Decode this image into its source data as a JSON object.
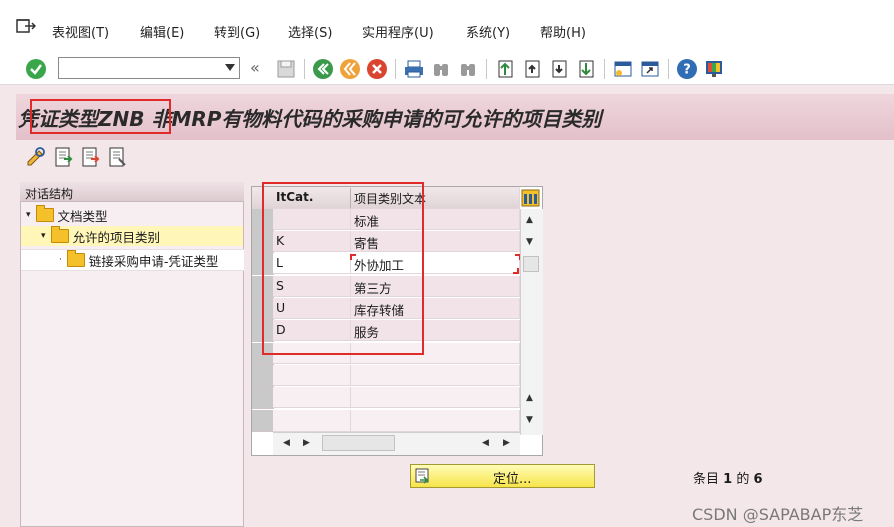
{
  "menu": {
    "items": [
      "表视图(T)",
      "编辑(E)",
      "转到(G)",
      "选择(S)",
      "实用程序(U)",
      "系统(Y)",
      "帮助(H)"
    ]
  },
  "toolbar": {
    "command_field": ""
  },
  "title": {
    "prefix": "凭证类型",
    "doc_type": "ZNB",
    "suffix": " 非MRP有物料代码的采购申请的可允许的项目类别"
  },
  "nav": {
    "header": "对话结构",
    "items": [
      {
        "label": "文档类型",
        "level": 0,
        "expanded": true
      },
      {
        "label": "允许的项目类别",
        "level": 1,
        "expanded": true,
        "selected": true
      },
      {
        "label": "链接采购申请-凭证类型",
        "level": 2,
        "expanded": false
      }
    ]
  },
  "table": {
    "columns": [
      "ItCat.",
      "项目类别文本"
    ],
    "rows": [
      [
        "",
        "标准"
      ],
      [
        "K",
        "寄售"
      ],
      [
        "L",
        "外协加工"
      ],
      [
        "S",
        "第三方"
      ],
      [
        "U",
        "库存转储"
      ],
      [
        "D",
        "服务"
      ]
    ]
  },
  "footer": {
    "position_button": "定位...",
    "entry_label": "条目",
    "entry_current": "1",
    "entry_of": "的",
    "entry_total": "6"
  },
  "watermark": "CSDN @SAPABAP东芝"
}
